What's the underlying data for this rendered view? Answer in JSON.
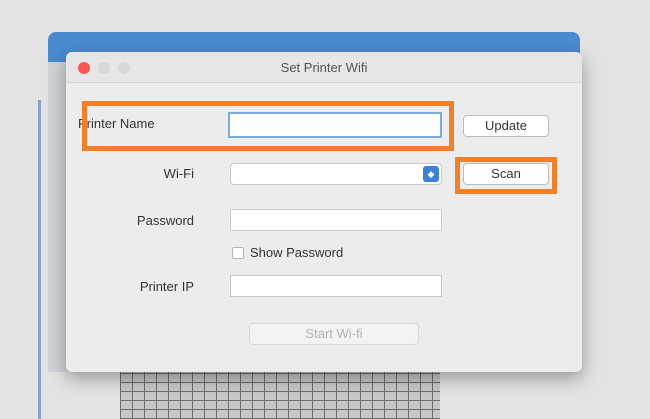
{
  "dialog": {
    "title": "Set Printer Wifi"
  },
  "form": {
    "printer_name_label": "Printer Name",
    "printer_name_value": "",
    "update_button": "Update",
    "wifi_label": "Wi-Fi",
    "wifi_selected": "",
    "scan_button": "Scan",
    "password_label": "Password",
    "password_value": "",
    "show_password_label": "Show Password",
    "show_password_checked": false,
    "printer_ip_label": "Printer IP",
    "printer_ip_value": "",
    "start_button": "Start Wi-fi"
  },
  "colors": {
    "highlight": "#f0802c",
    "close_button": "#fc5753",
    "select_arrow": "#3d82d6",
    "background_app_bar": "#4a8bd0"
  }
}
